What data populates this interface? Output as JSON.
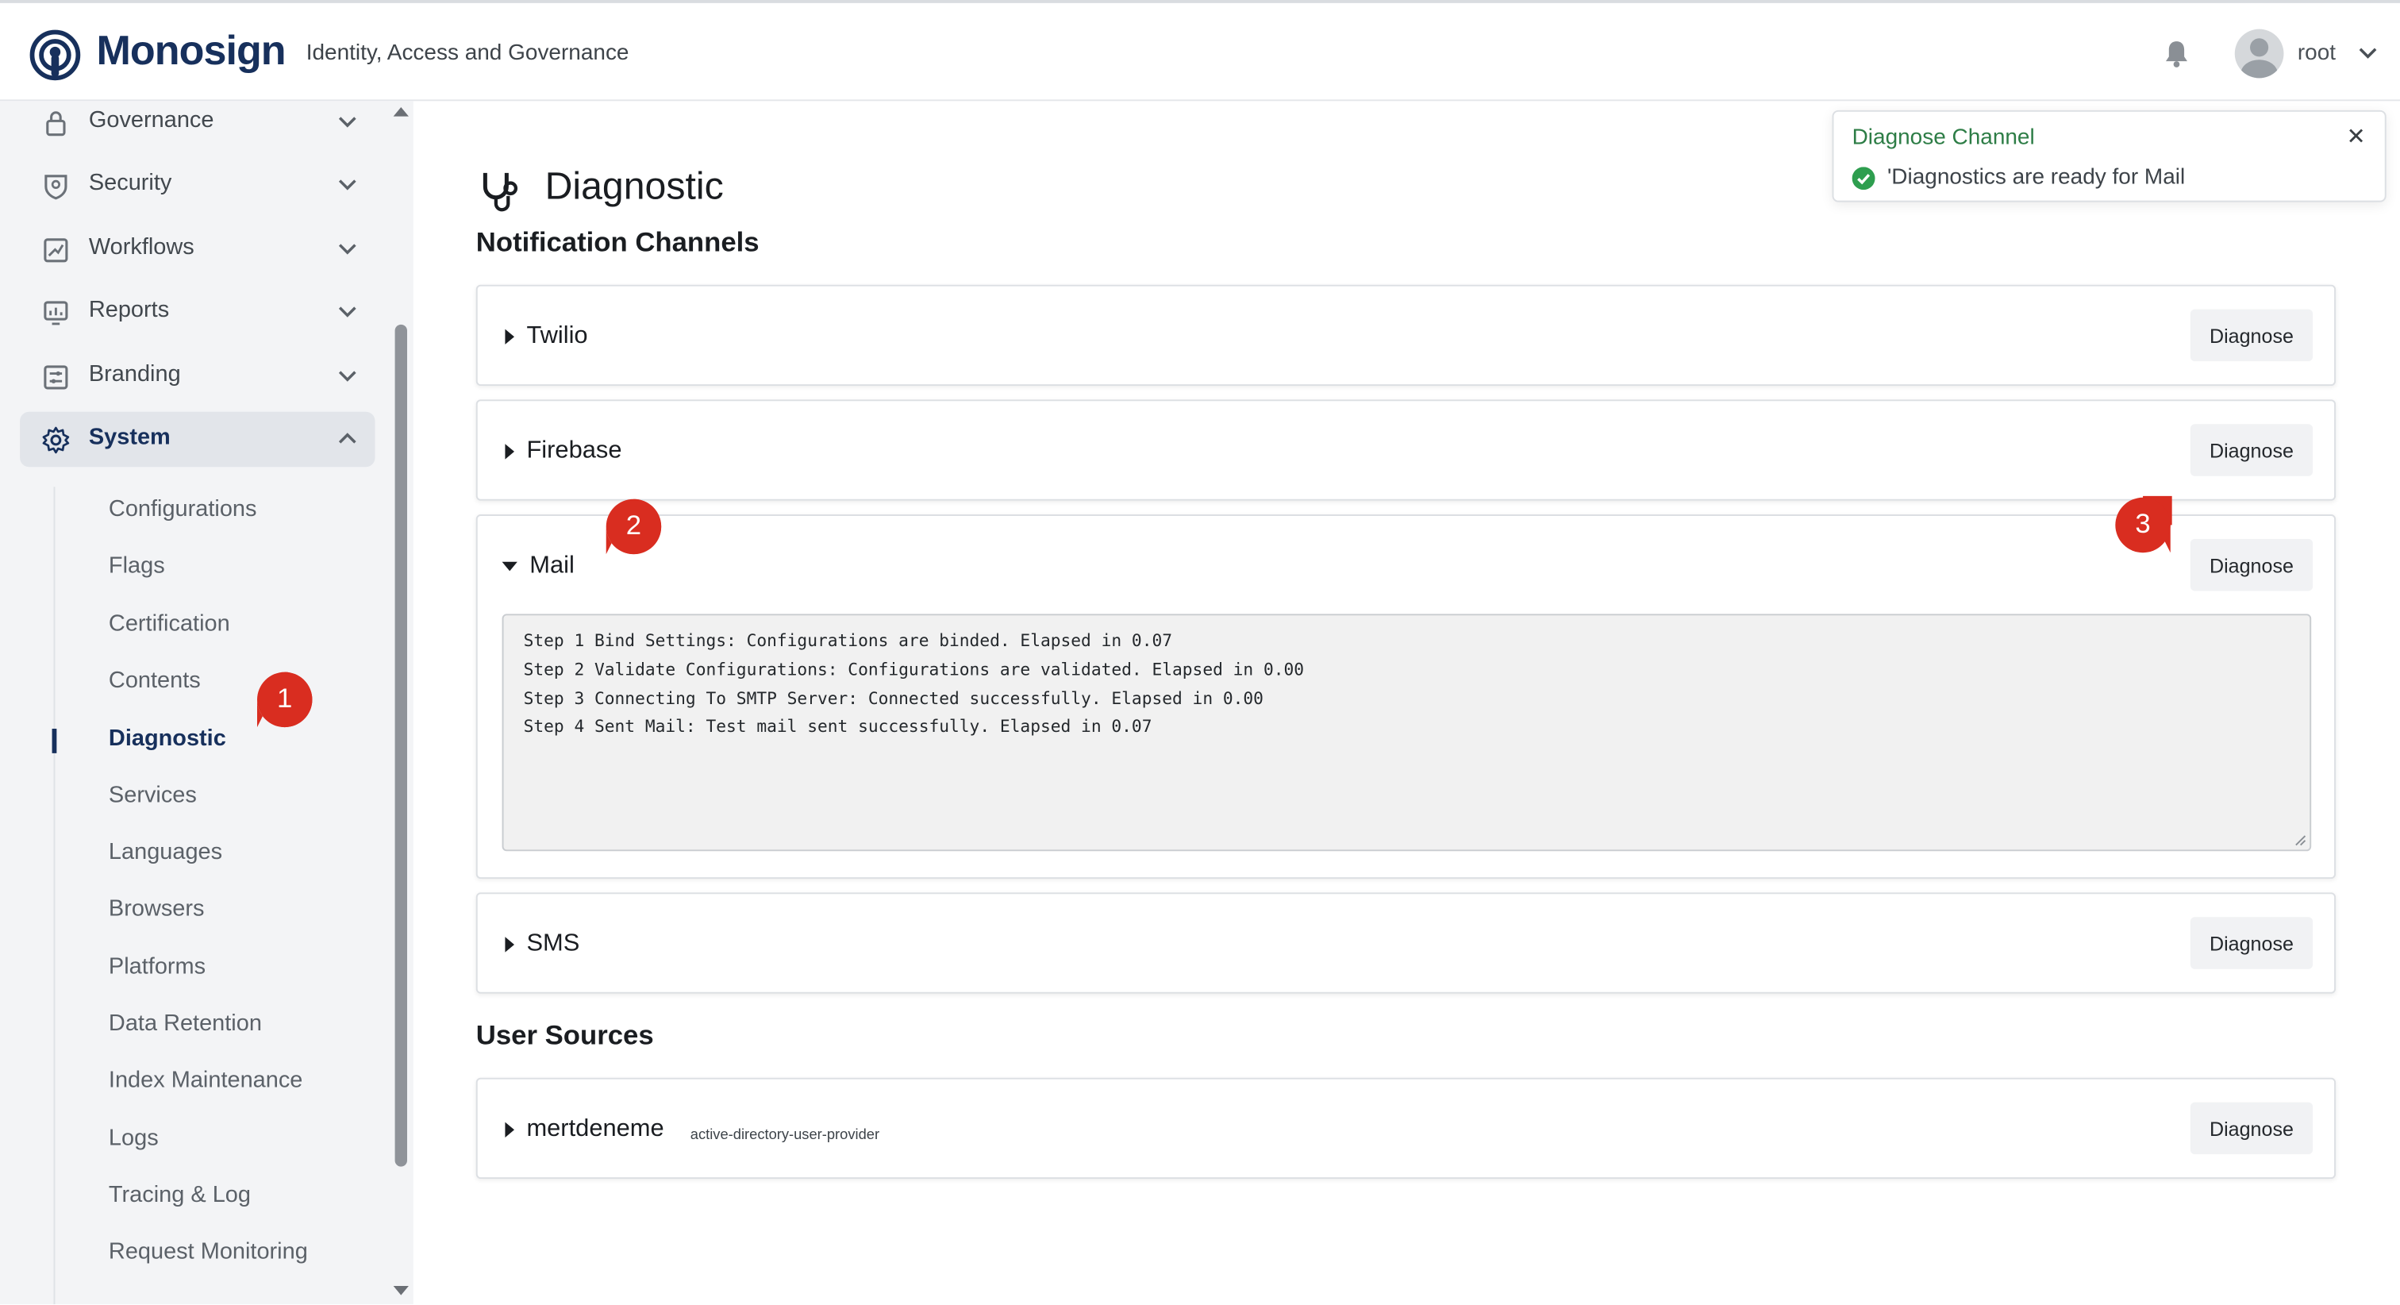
{
  "header": {
    "brand": "Monosign",
    "tagline": "Identity, Access and Governance",
    "username": "root",
    "icons": [
      "monosign-logo-icon",
      "bell-icon",
      "avatar-icon",
      "chevron-down-icon"
    ]
  },
  "sidebar": {
    "items": [
      {
        "label": "Governance",
        "icon": "lock-icon"
      },
      {
        "label": "Security",
        "icon": "shield-icon"
      },
      {
        "label": "Workflows",
        "icon": "workflow-icon"
      },
      {
        "label": "Reports",
        "icon": "reports-icon"
      },
      {
        "label": "Branding",
        "icon": "branding-icon"
      },
      {
        "label": "System",
        "icon": "gear-icon",
        "expanded": true
      }
    ],
    "system_sub_items": [
      "Configurations",
      "Flags",
      "Certification",
      "Contents",
      "Diagnostic",
      "Services",
      "Languages",
      "Browsers",
      "Platforms",
      "Data Retention",
      "Index Maintenance",
      "Logs",
      "Tracing & Log",
      "Request Monitoring"
    ],
    "active_sub_item": "Diagnostic"
  },
  "page": {
    "title": "Diagnostic",
    "notification_section": "Notification Channels",
    "user_sources_section": "User Sources",
    "diagnose_label": "Diagnose"
  },
  "channels": [
    {
      "name": "Twilio",
      "expanded": false
    },
    {
      "name": "Firebase",
      "expanded": false
    },
    {
      "name": "Mail",
      "expanded": true
    },
    {
      "name": "SMS",
      "expanded": false
    }
  ],
  "mail_output": [
    "Step 1 Bind Settings: Configurations are binded. Elapsed in 0.07",
    "Step 2 Validate Configurations: Configurations are validated. Elapsed in 0.00",
    "Step 3 Connecting To SMTP Server: Connected successfully. Elapsed in 0.00",
    "Step 4 Sent Mail: Test mail sent successfully. Elapsed in 0.07"
  ],
  "user_sources": [
    {
      "name": "mertdeneme",
      "type": "active-directory-user-provider"
    }
  ],
  "toast": {
    "title": "Diagnose Channel",
    "message": "'Diagnostics are ready for Mail",
    "icon": "check-circle-icon"
  },
  "markers": [
    "1",
    "2",
    "3"
  ],
  "colors": {
    "brand": "#17305c",
    "success": "#2d7d46",
    "marker": "#d92d20",
    "sidebar_bg": "#f3f4f6",
    "button_bg": "#f1f2f4"
  }
}
